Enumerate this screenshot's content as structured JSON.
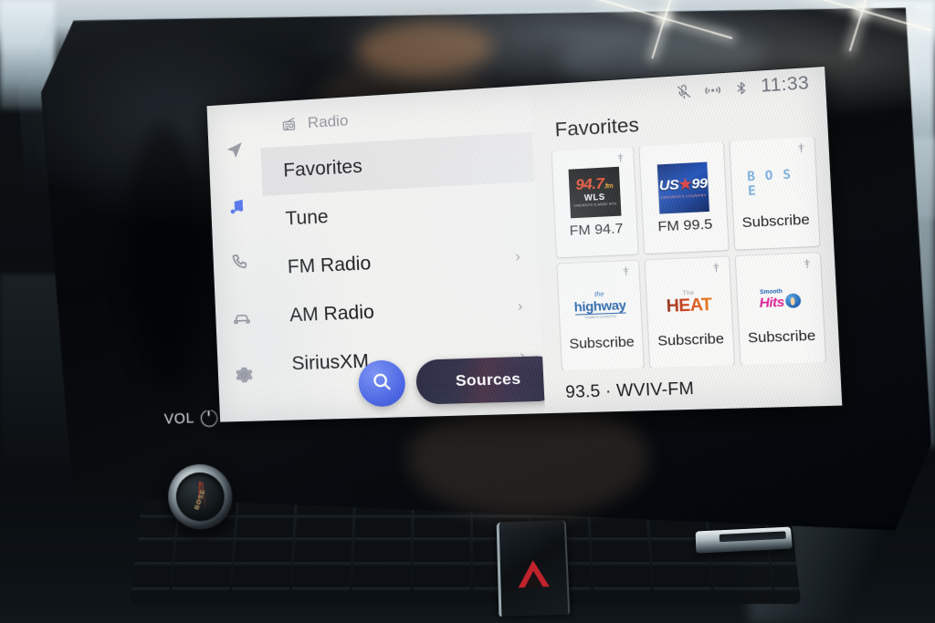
{
  "hardware": {
    "volume_label": "VOL",
    "power_icon": "power-icon",
    "knob_brand": "BOSE",
    "hazard_icon": "hazard-triangle-icon"
  },
  "statusbar": {
    "mic_muted_icon": "microphone-muted-icon",
    "broadcast_icon": "broadcast-signal-icon",
    "bluetooth_icon": "bluetooth-icon",
    "time": "11:33"
  },
  "header": {
    "source_icon": "radio-icon",
    "source_label": "Radio"
  },
  "rail": {
    "items": [
      {
        "name": "navigation",
        "icon": "navigation-arrow-icon",
        "active": false
      },
      {
        "name": "media",
        "icon": "music-note-icon",
        "active": true
      },
      {
        "name": "phone",
        "icon": "phone-icon",
        "active": false
      },
      {
        "name": "vehicle",
        "icon": "car-icon",
        "active": false
      },
      {
        "name": "settings",
        "icon": "gear-icon",
        "active": false
      }
    ]
  },
  "menu": {
    "items": [
      {
        "label": "Favorites",
        "selected": true,
        "chevron": ""
      },
      {
        "label": "Tune",
        "selected": false,
        "chevron": ""
      },
      {
        "label": "FM Radio",
        "selected": false,
        "chevron": "›"
      },
      {
        "label": "AM Radio",
        "selected": false,
        "chevron": "›"
      },
      {
        "label": "SiriusXM",
        "selected": false,
        "chevron": "›"
      }
    ]
  },
  "dock": {
    "search_icon": "search-icon",
    "sources_label": "Sources"
  },
  "content": {
    "title": "Favorites",
    "tiles": [
      {
        "logo": "wls-947",
        "label": "FM 94.7",
        "pin": true,
        "logo_text": {
          "big": "94.7",
          "small": ".fm",
          "call": "WLS",
          "tag": "CHICAGO'S CLASSIC HITS"
        }
      },
      {
        "logo": "us-99",
        "label": "FM 99.5",
        "pin": false,
        "logo_text": {
          "big": "US",
          "star": "★",
          "num": "99",
          "tag": "CHICAGO'S COUNTRY"
        }
      },
      {
        "logo": "bose-sxm",
        "label": "Subscribe",
        "pin": true,
        "logo_text": {
          "big": "B O S E"
        }
      },
      {
        "logo": "the-highway",
        "label": "Subscribe",
        "pin": true,
        "logo_text": {
          "the": "the",
          "big": "highway",
          "tag": "TODAY'S COUNTRY"
        }
      },
      {
        "logo": "the-heat",
        "label": "Subscribe",
        "pin": true,
        "logo_text": {
          "the": "The",
          "big": "HEAT"
        }
      },
      {
        "logo": "smooth-hits",
        "label": "Subscribe",
        "pin": true,
        "logo_text": {
          "sm": "Smooth",
          "big": "Hits"
        }
      }
    ],
    "now_playing": "93.5 · WVIV-FM"
  },
  "colors": {
    "accent_blue": "#4a6ef0",
    "screen_bg": "#f3f3f1",
    "tile_bg": "#fbfbfa",
    "text_primary": "#17181c",
    "text_muted": "#92949d",
    "sources_btn": "#2d2e46"
  }
}
